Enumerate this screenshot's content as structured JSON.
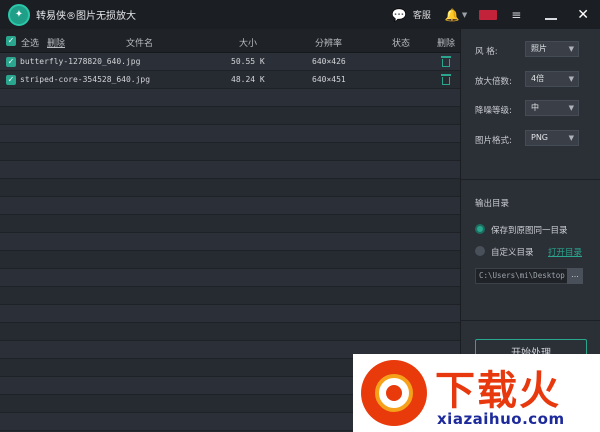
{
  "app": {
    "title": "转易侠®图片无损放大"
  },
  "titlebar": {
    "kefu_label": "客服"
  },
  "table": {
    "select_all_label": "全选",
    "delete_link": "删除",
    "columns": {
      "filename": "文件名",
      "size": "大小",
      "resolution": "分辨率",
      "status": "状态",
      "delete": "删除"
    },
    "rows": [
      {
        "name": "butterfly-1278820_640.jpg",
        "size": "50.55 K",
        "resolution": "640×426",
        "status": ""
      },
      {
        "name": "striped-core-354528_640.jpg",
        "size": "48.24 K",
        "resolution": "640×451",
        "status": ""
      }
    ]
  },
  "panel": {
    "style_label": "风    格:",
    "style_value": "照片",
    "scale_label": "放大倍数:",
    "scale_value": "4倍",
    "denoise_label": "降噪等级:",
    "denoise_value": "中",
    "format_label": "图片格式:",
    "format_value": "PNG",
    "output_title": "输出目录",
    "radio_same": "保存到原图同一目录",
    "radio_custom": "自定义目录",
    "open_dir": "打开目录",
    "path": "C:\\Users\\mi\\Desktop",
    "browse": "...",
    "start_button": "开始处理"
  },
  "watermark": {
    "text": "下载火",
    "url": "xiazaihuo.com"
  },
  "colors": {
    "accent": "#2aa58e",
    "bg": "#24282f",
    "panel": "#2b2f36"
  }
}
